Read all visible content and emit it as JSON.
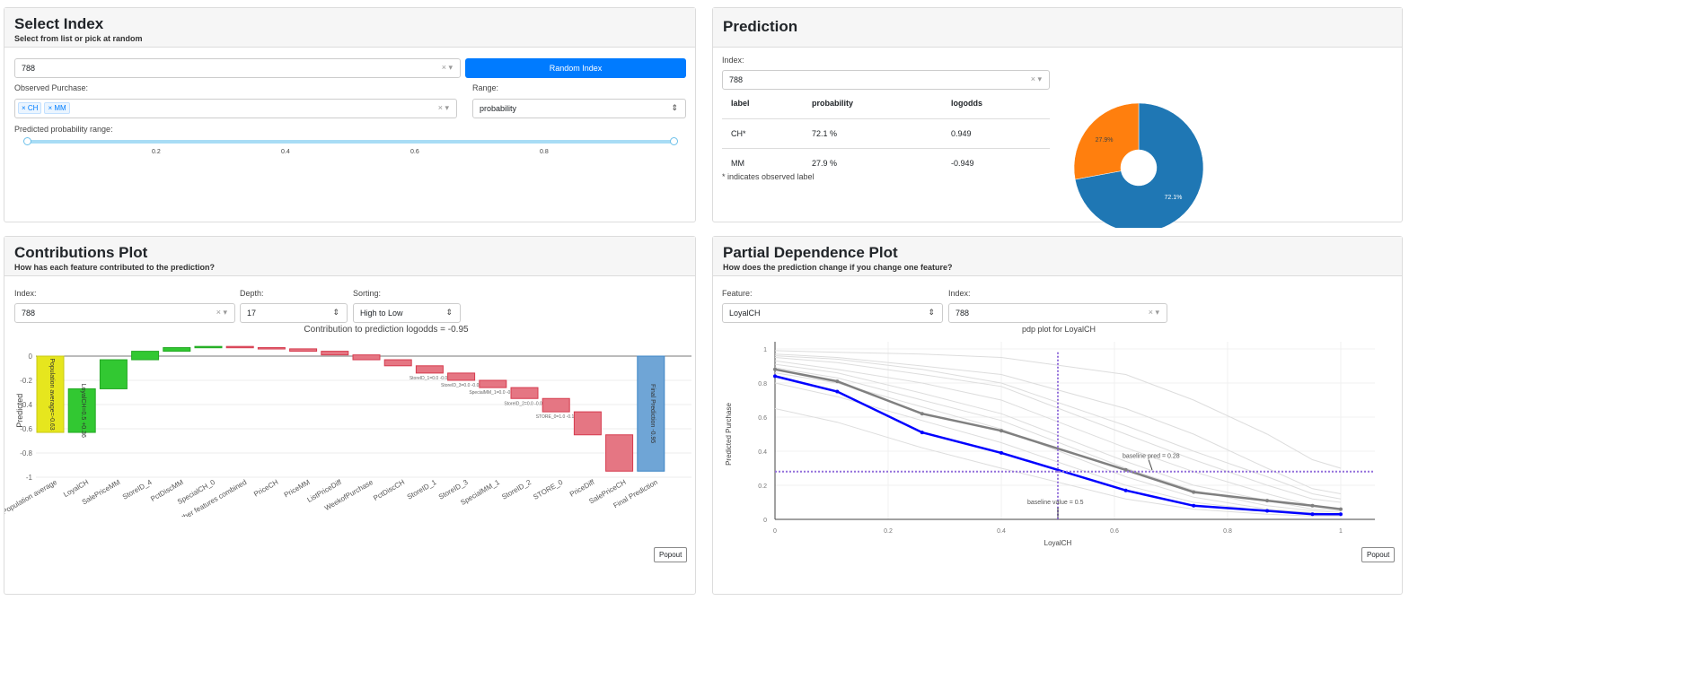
{
  "select_index": {
    "title": "Select Index",
    "subtitle": "Select from list or pick at random",
    "index_value": "788",
    "random_button": "Random Index",
    "observed_label": "Observed Purchase:",
    "observed_tags": [
      "CH",
      "MM"
    ],
    "range_label": "Range:",
    "range_value": "probability",
    "prob_range_label": "Predicted probability range:",
    "slider_ticks": [
      "0.2",
      "0.4",
      "0.6",
      "0.8"
    ],
    "slider_range": [
      0,
      1
    ]
  },
  "prediction": {
    "title": "Prediction",
    "index_label": "Index:",
    "index_value": "788",
    "columns": [
      "label",
      "probability",
      "logodds"
    ],
    "rows": [
      [
        "CH*",
        "72.1 %",
        "0.949"
      ],
      [
        "MM",
        "27.9 %",
        "-0.949"
      ]
    ],
    "note": "* indicates observed label",
    "pie": {
      "slices": [
        {
          "label": "CH",
          "value": 72.1,
          "text": "72.1%",
          "color": "#1f77b4"
        },
        {
          "label": "MM",
          "value": 27.9,
          "text": "27.9%",
          "color": "#ff7f0e"
        }
      ]
    }
  },
  "contributions": {
    "title": "Contributions Plot",
    "subtitle": "How has each feature contributed to the prediction?",
    "index_label": "Index:",
    "index_value": "788",
    "depth_label": "Depth:",
    "depth_value": "17",
    "sorting_label": "Sorting:",
    "sorting_value": "High to Low",
    "popout": "Popout"
  },
  "pdp": {
    "title": "Partial Dependence Plot",
    "subtitle": "How does the prediction change if you change one feature?",
    "feature_label": "Feature:",
    "feature_value": "LoyalCH",
    "index_label": "Index:",
    "index_value": "788",
    "popout": "Popout"
  },
  "chart_data": [
    {
      "type": "bar",
      "subtype": "waterfall",
      "title": "Contribution to prediction logodds = -0.95",
      "ylabel": "Predicted",
      "ylim": [
        -1,
        0.05
      ],
      "yticks": [
        "0",
        "-0.2",
        "-0.4",
        "-0.6",
        "-0.8",
        "-1"
      ],
      "grid": true,
      "categories": [
        "Population average",
        "LoyalCH",
        "SalePriceMM",
        "StoreID_4",
        "PctDiscMM",
        "SpecialCH_0",
        "Other features combined",
        "PriceCH",
        "PriceMM",
        "ListPriceDiff",
        "WeekofPurchase",
        "PctDiscCH",
        "StoreID_1",
        "StoreID_3",
        "SpecialMM_1",
        "StoreID_2",
        "STORE_0",
        "PriceDiff",
        "SalePriceCH",
        "Final Prediction"
      ],
      "values": [
        -0.63,
        0.36,
        0.24,
        0.07,
        0.03,
        0.01,
        -0.01,
        -0.01,
        -0.02,
        -0.03,
        -0.04,
        -0.05,
        -0.06,
        -0.06,
        -0.06,
        -0.09,
        -0.11,
        -0.19,
        -0.3,
        -0.95
      ],
      "bar_labels": [
        "Population average=-0.63",
        "LoyalCH=0.5 +0.36",
        "",
        "",
        "",
        "",
        "",
        "",
        "",
        "",
        "",
        "",
        "StoreID_1=0.0 -0.06",
        "StoreID_3=0.0 -0.06",
        "SpecialMM_1=0.0 -0.06",
        "StoreID_2=0.0 -0.09",
        "STORE_0=1.0 -0.11",
        "",
        "",
        "Final Prediction -0.95"
      ],
      "colors": {
        "base": "#e6e61e",
        "positive": "#32c832",
        "negative": "#e57683",
        "final": "#6fa5d6"
      }
    },
    {
      "type": "line",
      "title": "pdp plot for LoyalCH",
      "xlabel": "LoyalCH",
      "ylabel": "Predicted Purchase",
      "xlim": [
        0,
        1
      ],
      "ylim": [
        0,
        1
      ],
      "xticks": [
        "0",
        "0.2",
        "0.4",
        "0.6",
        "0.8",
        "1"
      ],
      "yticks": [
        "0",
        "0.2",
        "0.4",
        "0.6",
        "0.8",
        "1"
      ],
      "x": [
        0,
        0.11,
        0.26,
        0.4,
        0.62,
        0.74,
        0.87,
        0.95,
        1
      ],
      "series": [
        {
          "role": "index",
          "color": "#0000ff",
          "values": [
            0.84,
            0.75,
            0.51,
            0.39,
            0.17,
            0.08,
            0.05,
            0.03,
            0.03
          ]
        },
        {
          "role": "average",
          "color": "#808080",
          "values": [
            0.88,
            0.81,
            0.62,
            0.52,
            0.29,
            0.16,
            0.11,
            0.08,
            0.06
          ]
        }
      ],
      "ice_lines": [
        [
          0.99,
          0.98,
          0.97,
          0.95,
          0.85,
          0.7,
          0.5,
          0.35,
          0.3
        ],
        [
          0.97,
          0.95,
          0.9,
          0.85,
          0.65,
          0.5,
          0.3,
          0.18,
          0.15
        ],
        [
          0.95,
          0.92,
          0.85,
          0.78,
          0.5,
          0.35,
          0.2,
          0.12,
          0.1
        ],
        [
          0.93,
          0.88,
          0.8,
          0.7,
          0.42,
          0.28,
          0.15,
          0.08,
          0.06
        ],
        [
          0.91,
          0.86,
          0.74,
          0.62,
          0.34,
          0.2,
          0.11,
          0.06,
          0.05
        ],
        [
          0.89,
          0.83,
          0.7,
          0.58,
          0.3,
          0.17,
          0.08,
          0.05,
          0.04
        ],
        [
          0.86,
          0.8,
          0.66,
          0.53,
          0.25,
          0.13,
          0.06,
          0.04,
          0.03
        ],
        [
          0.8,
          0.72,
          0.58,
          0.45,
          0.2,
          0.1,
          0.05,
          0.03,
          0.02
        ],
        [
          0.65,
          0.57,
          0.42,
          0.3,
          0.12,
          0.06,
          0.03,
          0.02,
          0.02
        ],
        [
          0.96,
          0.94,
          0.88,
          0.8,
          0.55,
          0.4,
          0.25,
          0.15,
          0.12
        ]
      ],
      "annotations": [
        {
          "text": "baseline pred = 0.28",
          "y": 0.28
        },
        {
          "text": "baseline value = 0.5",
          "x": 0.5
        }
      ]
    }
  ]
}
